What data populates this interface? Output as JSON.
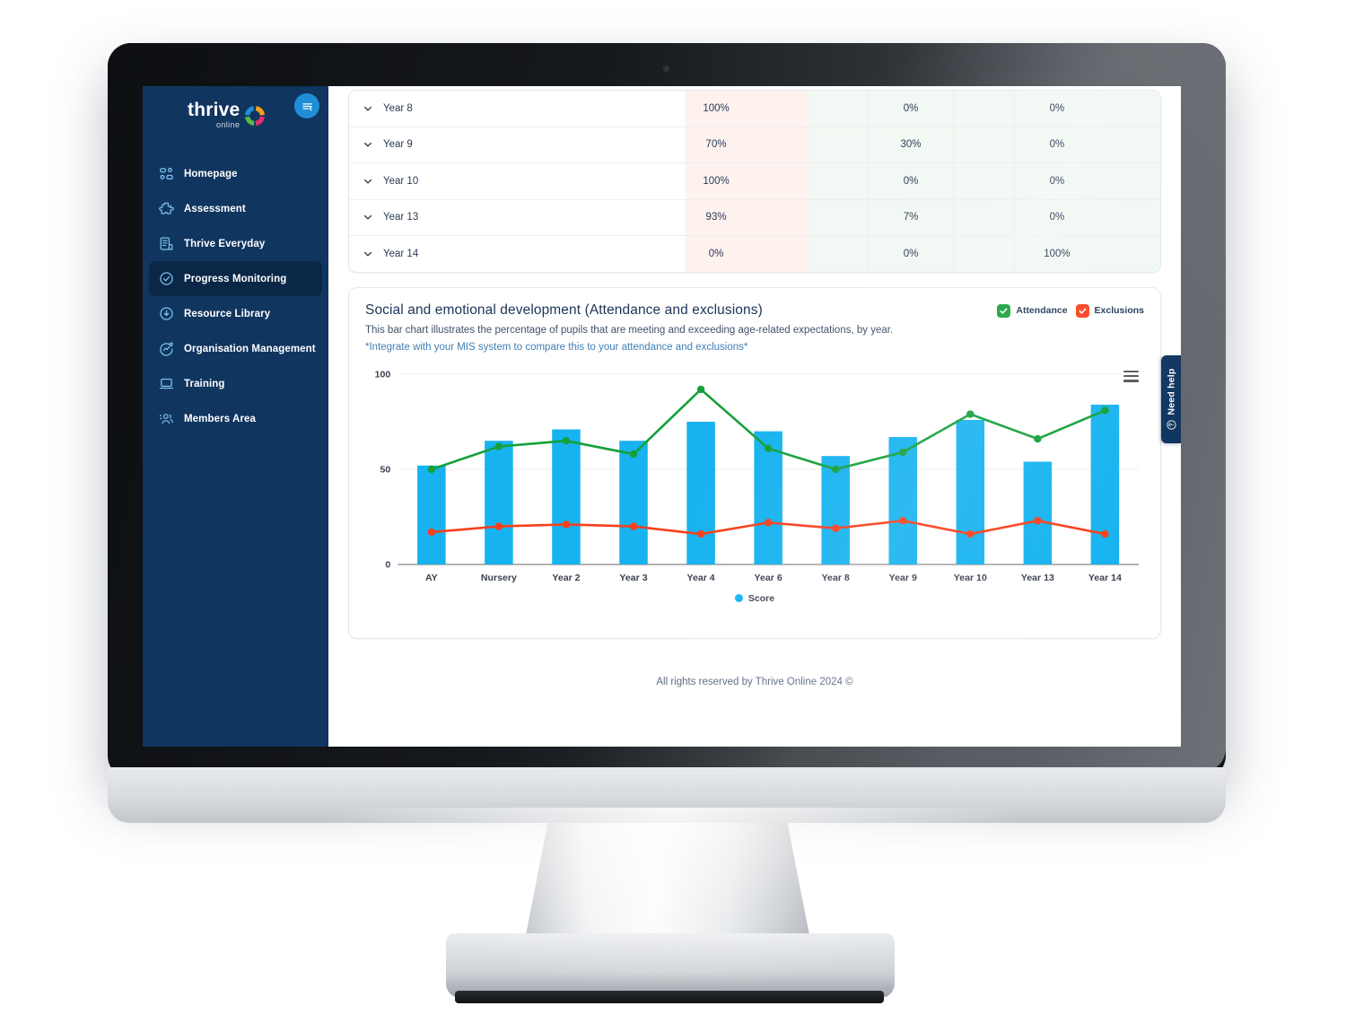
{
  "brand": {
    "logo_main": "thrive",
    "logo_sub": "online",
    "menu_toggle_icon": "menu-collapse-icon"
  },
  "sidebar": {
    "items": [
      {
        "label": "Homepage",
        "icon": "dashboard-icon",
        "active": false
      },
      {
        "label": "Assessment",
        "icon": "puzzle-icon",
        "active": false
      },
      {
        "label": "Thrive Everyday",
        "icon": "document-icon",
        "active": false
      },
      {
        "label": "Progress Monitoring",
        "icon": "check-circle-icon",
        "active": true
      },
      {
        "label": "Resource Library",
        "icon": "download-circle-icon",
        "active": false
      },
      {
        "label": "Organisation Management",
        "icon": "gauge-icon",
        "active": false
      },
      {
        "label": "Training",
        "icon": "laptop-icon",
        "active": false
      },
      {
        "label": "Members Area",
        "icon": "users-icon",
        "active": false
      }
    ]
  },
  "table": {
    "rows": [
      {
        "name": "Year 8",
        "col1": "100%",
        "col2": "",
        "col3": "0%",
        "col4": "0%",
        "col5": ""
      },
      {
        "name": "Year 9",
        "col1": "70%",
        "col2": "",
        "col3": "30%",
        "col4": "0%",
        "col5": ""
      },
      {
        "name": "Year 10",
        "col1": "100%",
        "col2": "",
        "col3": "0%",
        "col4": "0%",
        "col5": ""
      },
      {
        "name": "Year 13",
        "col1": "93%",
        "col2": "",
        "col3": "7%",
        "col4": "0%",
        "col5": ""
      },
      {
        "name": "Year 14",
        "col1": "0%",
        "col2": "",
        "col3": "0%",
        "col4": "100%",
        "col5": ""
      }
    ],
    "expand_icon": "chevron-down-icon"
  },
  "chart_card": {
    "title": "Social and emotional development (Attendance and exclusions)",
    "subtitle": "This bar chart illustrates the percentage of pupils that are meeting and exceeding age-related expectations, by year.",
    "note": "*Integrate with your MIS system to compare this to your attendance and exclusions*",
    "legend_top": [
      {
        "label": "Attendance",
        "color": "#15a03a",
        "checked": true
      },
      {
        "label": "Exclusions",
        "color": "#f8401d",
        "checked": true
      }
    ],
    "menu_icon": "chart-menu-icon"
  },
  "chart_data": {
    "type": "bar",
    "title": "Social and emotional development (Attendance and exclusions)",
    "xlabel": "",
    "ylabel": "",
    "ylim": [
      0,
      100
    ],
    "yticks": [
      0,
      50,
      100
    ],
    "grid": true,
    "legend_position": "bottom",
    "categories": [
      "AY",
      "Nursery",
      "Year 2",
      "Year 3",
      "Year 4",
      "Year 6",
      "Year 8",
      "Year 9",
      "Year 10",
      "Year 13",
      "Year 14"
    ],
    "series": [
      {
        "name": "Score",
        "type": "bar",
        "color": "#17b3f0",
        "values": [
          52,
          65,
          71,
          65,
          75,
          70,
          57,
          67,
          76,
          54,
          84
        ]
      },
      {
        "name": "Attendance",
        "type": "line",
        "color": "#15a03a",
        "values": [
          50,
          62,
          65,
          58,
          92,
          61,
          50,
          59,
          79,
          66,
          81
        ]
      },
      {
        "name": "Exclusions",
        "type": "line",
        "color": "#f8401d",
        "values": [
          17,
          20,
          21,
          20,
          16,
          22,
          19,
          23,
          16,
          23,
          16
        ]
      }
    ],
    "bottom_legend": [
      {
        "label": "Score",
        "color": "#17b3f0"
      }
    ]
  },
  "help": {
    "label": "Need help",
    "icon": "question-circle-icon"
  },
  "footer": {
    "text": "All rights reserved by Thrive Online 2024 ©"
  }
}
